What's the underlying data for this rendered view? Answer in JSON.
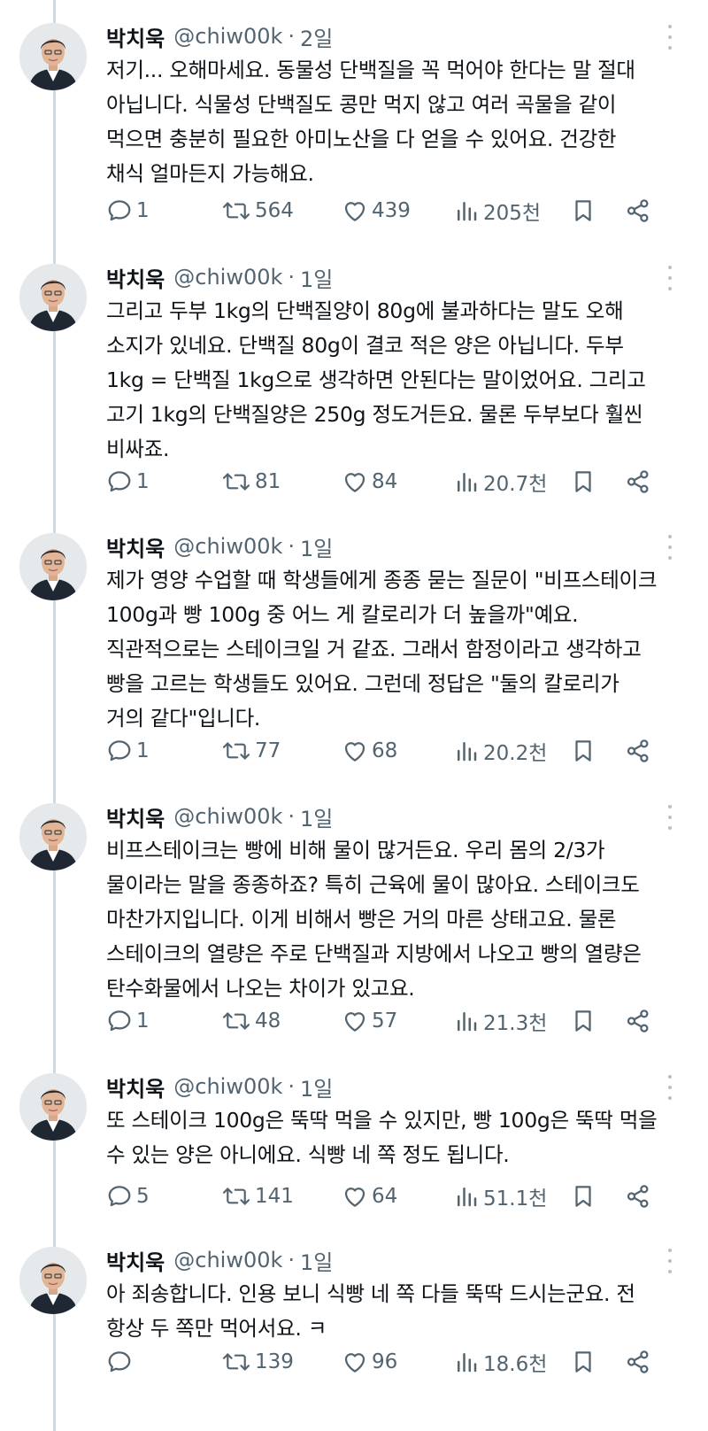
{
  "tweets": [
    {
      "name": "박치욱",
      "handle": "@chiw00k",
      "time": "2일",
      "text": "저기... 오해마세요. 동물성 단백질을 꼭 먹어야 한다는 말 절대\n아닙니다. 식물성 단백질도 콩만 먹지 않고 여러 곡물을 같이\n먹으면 충분히 필요한 아미노산을 다 얻을 수 있어요. 건강한\n채식 얼마든지 가능해요.",
      "replies": "1",
      "retweets": "564",
      "likes": "439",
      "views": "205천"
    },
    {
      "name": "박치욱",
      "handle": "@chiw00k",
      "time": "1일",
      "text": "그리고 두부 1kg의 단백질양이 80g에 불과하다는 말도 오해\n소지가 있네요. 단백질 80g이 결코 적은 양은 아닙니다. 두부\n1kg = 단백질 1kg으로 생각하면 안된다는 말이었어요. 그리고\n고기 1kg의 단백질양은 250g 정도거든요. 물론 두부보다 훨씬\n비싸죠.",
      "replies": "1",
      "retweets": "81",
      "likes": "84",
      "views": "20.7천"
    },
    {
      "name": "박치욱",
      "handle": "@chiw00k",
      "time": "1일",
      "text": "제가 영양 수업할 때 학생들에게 종종 묻는 질문이 \"비프스테이크\n100g과 빵 100g 중 어느 게 칼로리가 더 높을까\"예요.\n직관적으로는 스테이크일 거 같죠. 그래서 함정이라고 생각하고\n빵을 고르는 학생들도 있어요. 그런데 정답은 \"둘의 칼로리가\n거의 같다\"입니다.",
      "replies": "1",
      "retweets": "77",
      "likes": "68",
      "views": "20.2천"
    },
    {
      "name": "박치욱",
      "handle": "@chiw00k",
      "time": "1일",
      "text": "비프스테이크는 빵에 비해 물이 많거든요. 우리 몸의 2/3가\n물이라는 말을 종종하죠? 특히 근육에 물이 많아요. 스테이크도\n마찬가지입니다. 이게 비해서 빵은 거의 마른 상태고요. 물론\n스테이크의 열량은 주로 단백질과 지방에서 나오고 빵의 열량은\n탄수화물에서 나오는 차이가 있고요.",
      "replies": "1",
      "retweets": "48",
      "likes": "57",
      "views": "21.3천"
    },
    {
      "name": "박치욱",
      "handle": "@chiw00k",
      "time": "1일",
      "text": "또 스테이크 100g은 뚝딱 먹을 수 있지만, 빵 100g은 뚝딱 먹을\n수 있는 양은 아니에요. 식빵 네 쪽 정도 됩니다.",
      "replies": "5",
      "retweets": "141",
      "likes": "64",
      "views": "51.1천"
    },
    {
      "name": "박치욱",
      "handle": "@chiw00k",
      "time": "1일",
      "text": "아 죄송합니다. 인용 보니 식빵 네 쪽 다들 뚝딱 드시는군요. 전\n항상 두 쪽만 먹어서요. ㅋ",
      "replies": "",
      "retweets": "139",
      "likes": "96",
      "views": "18.6천"
    }
  ]
}
